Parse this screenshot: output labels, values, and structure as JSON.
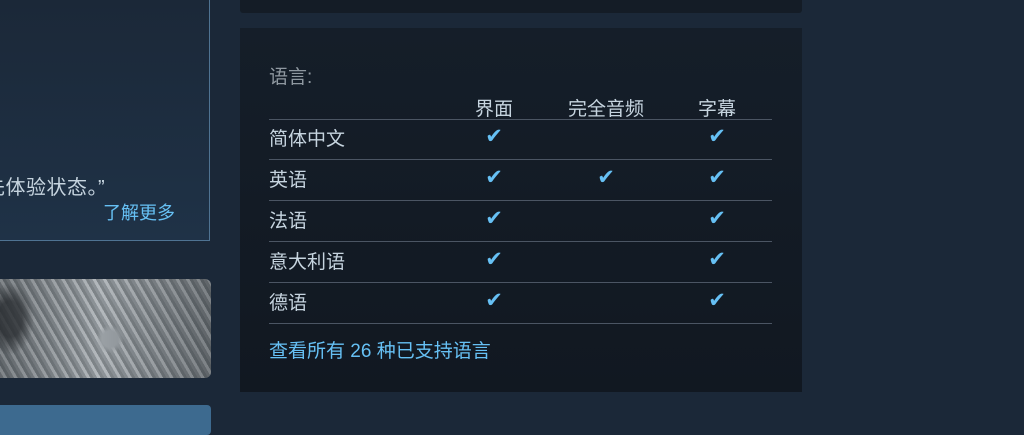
{
  "early_access": {
    "quote_text": "先体验状态。”",
    "learn_more": "了解更多"
  },
  "languages": {
    "title": "语言:",
    "columns": [
      "界面",
      "完全音频",
      "字幕"
    ],
    "rows": [
      {
        "name": "简体中文",
        "interface": true,
        "full_audio": false,
        "subtitles": true
      },
      {
        "name": "英语",
        "interface": true,
        "full_audio": true,
        "subtitles": true
      },
      {
        "name": "法语",
        "interface": true,
        "full_audio": false,
        "subtitles": true
      },
      {
        "name": "意大利语",
        "interface": true,
        "full_audio": false,
        "subtitles": true
      },
      {
        "name": "德语",
        "interface": true,
        "full_audio": false,
        "subtitles": true
      }
    ],
    "check_glyph": "✔",
    "see_all_link": "查看所有 26 种已支持语言"
  },
  "colors": {
    "background": "#1b2838",
    "accent_link": "#66c0f4",
    "panel": "#131a24",
    "text_muted": "#8f98a0"
  }
}
